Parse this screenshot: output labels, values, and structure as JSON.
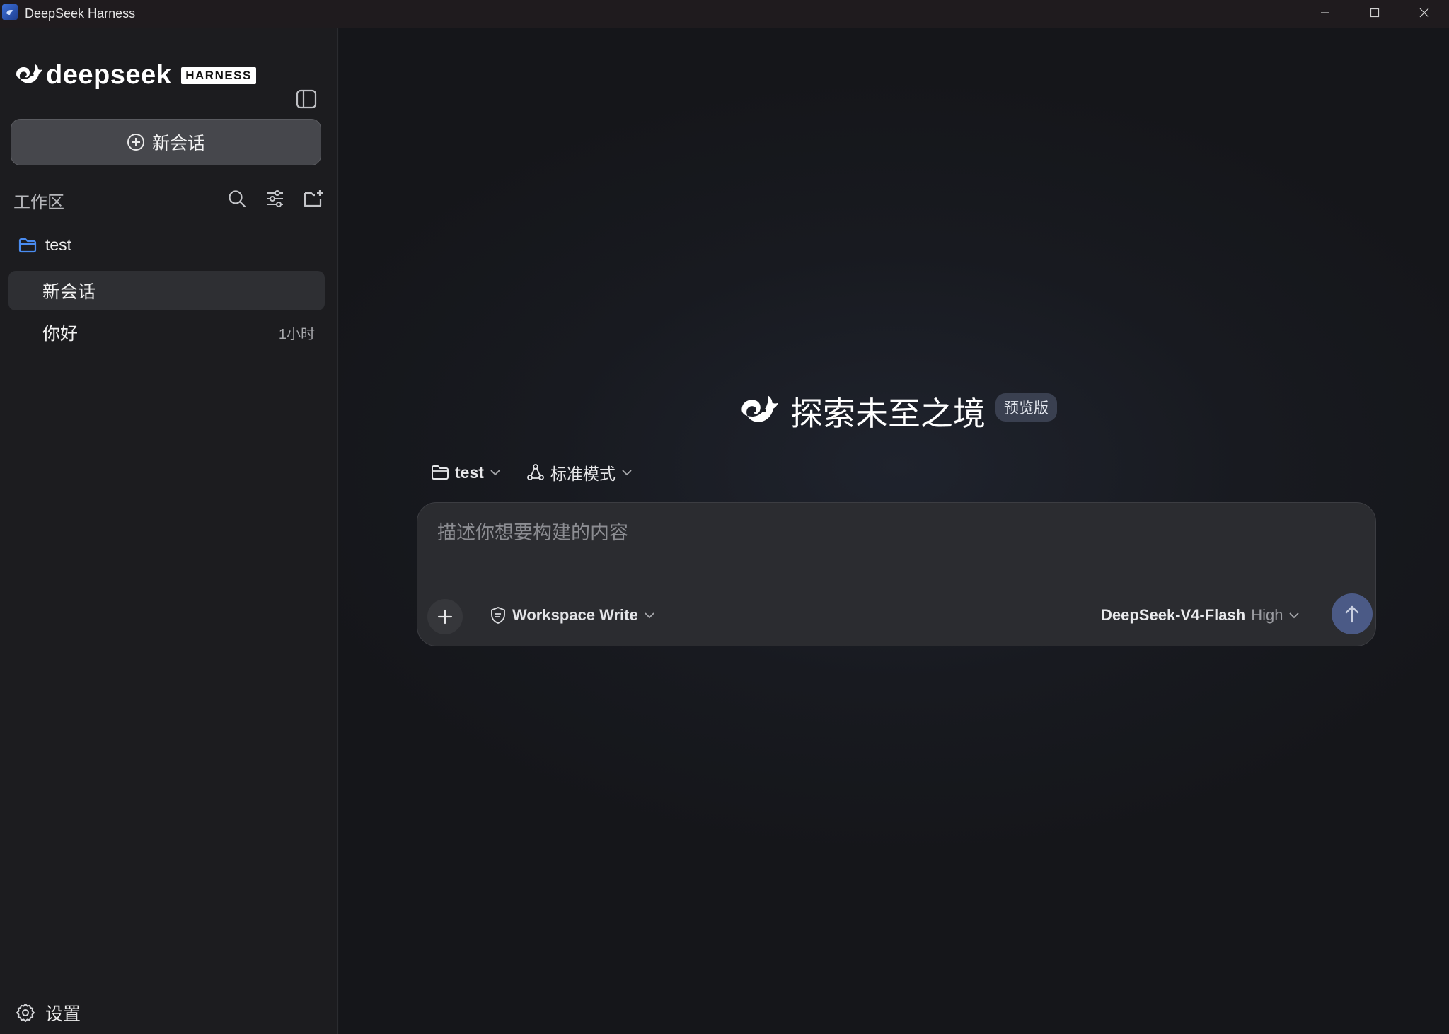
{
  "window": {
    "title": "DeepSeek Harness"
  },
  "sidebar": {
    "brand_name": "deepseek",
    "brand_badge": "HARNESS",
    "new_chat_label": "新会话",
    "workspace_title": "工作区",
    "folder": {
      "name": "test"
    },
    "chats": [
      {
        "label": "新会话",
        "time": ""
      },
      {
        "label": "你好",
        "time": "1小时"
      }
    ],
    "settings_label": "设置"
  },
  "main": {
    "hero_title": "探索未至之境",
    "hero_badge": "预览版",
    "workspace_select": "test",
    "mode_select": "标准模式",
    "composer": {
      "placeholder": "描述你想要构建的内容",
      "value": "",
      "permission": "Workspace Write",
      "model": "DeepSeek-V4-Flash",
      "reasoning_level": "High"
    }
  },
  "colors": {
    "background": "#17181b",
    "sidebar": "#1c1c1f",
    "accent_folder": "#4a8cf0",
    "send_button": "#4b5a86"
  },
  "icons": [
    "whale-logo-icon",
    "sidebar-toggle-icon",
    "plus-circle-icon",
    "search-icon",
    "filter-icon",
    "new-folder-icon",
    "folder-icon",
    "gear-icon",
    "chevron-down-icon",
    "mode-icon",
    "shield-icon",
    "plus-icon",
    "arrow-up-icon"
  ]
}
